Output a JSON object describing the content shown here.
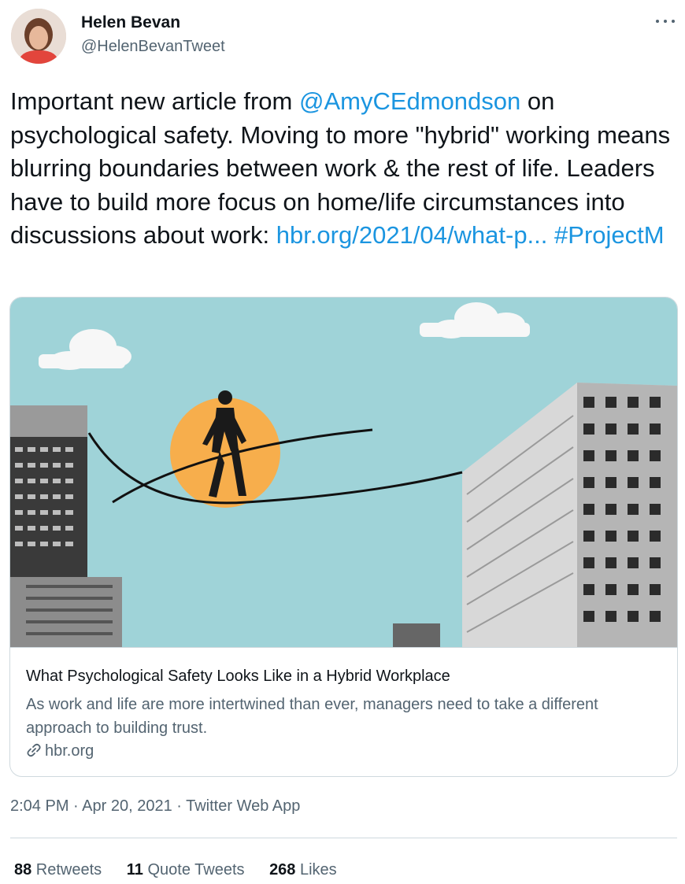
{
  "tweet": {
    "author": {
      "name": "Helen Bevan",
      "handle": "@HelenBevanTweet"
    },
    "text": {
      "part1": "Important new article from ",
      "mention": "@AmyCEdmondson",
      "part2": " on psychological safety. Moving to more \"hybrid\" working means blurring boundaries between work & the rest of life. Leaders have to build more focus on home/life circumstances into discussions about work: ",
      "link": "hbr.org/2021/04/what-p...",
      "space": " ",
      "hashtag": "#ProjectM"
    },
    "card": {
      "title": "What Psychological Safety Looks Like in a Hybrid Workplace",
      "description": "As work and life are more intertwined than ever, managers need to take a different approach to building trust.",
      "domain": "hbr.org",
      "icon": "link-icon"
    },
    "meta": {
      "time": "2:04 PM",
      "sep1": " · ",
      "date": "Apr 20, 2021",
      "sep2": " · ",
      "source": "Twitter Web App"
    },
    "stats": {
      "retweets": {
        "count": "88",
        "label": " Retweets"
      },
      "quotes": {
        "count": "11",
        "label": " Quote Tweets"
      },
      "likes": {
        "count": "268",
        "label": " Likes"
      }
    }
  },
  "colors": {
    "link": "#1b95e0",
    "sky": "#9fd3d8",
    "sun": "#f7ae4c",
    "secondary_text": "#536471",
    "border": "#cfd9de"
  }
}
